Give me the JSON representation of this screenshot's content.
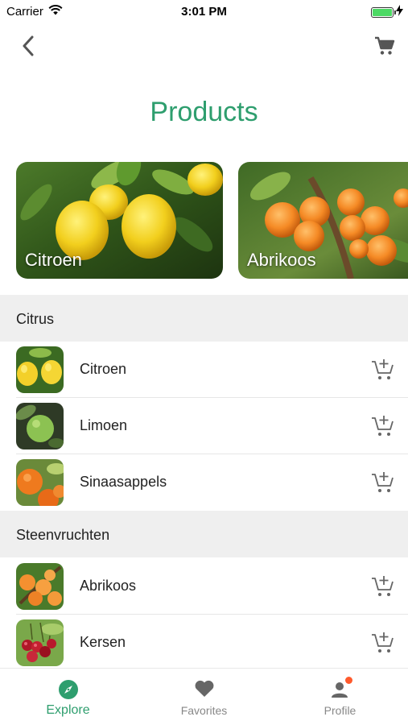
{
  "status_bar": {
    "carrier": "Carrier",
    "time": "3:01 PM"
  },
  "nav": {
    "back_icon": "chevron-left-icon",
    "cart_icon": "cart-icon"
  },
  "title": "Products",
  "featured": [
    {
      "label": "Citroen"
    },
    {
      "label": "Abrikoos"
    }
  ],
  "sections": [
    {
      "title": "Citrus",
      "items": [
        {
          "name": "Citroen"
        },
        {
          "name": "Limoen"
        },
        {
          "name": "Sinaasappels"
        }
      ]
    },
    {
      "title": "Steenvruchten",
      "items": [
        {
          "name": "Abrikoos"
        },
        {
          "name": "Kersen"
        }
      ]
    }
  ],
  "tabs": [
    {
      "label": "Explore",
      "icon": "compass-icon",
      "active": true
    },
    {
      "label": "Favorites",
      "icon": "heart-icon",
      "active": false
    },
    {
      "label": "Profile",
      "icon": "user-icon",
      "active": false,
      "badge": true
    }
  ],
  "colors": {
    "accent": "#2e9e6e",
    "section_bg": "#efefef",
    "badge": "#ff5a2c"
  }
}
